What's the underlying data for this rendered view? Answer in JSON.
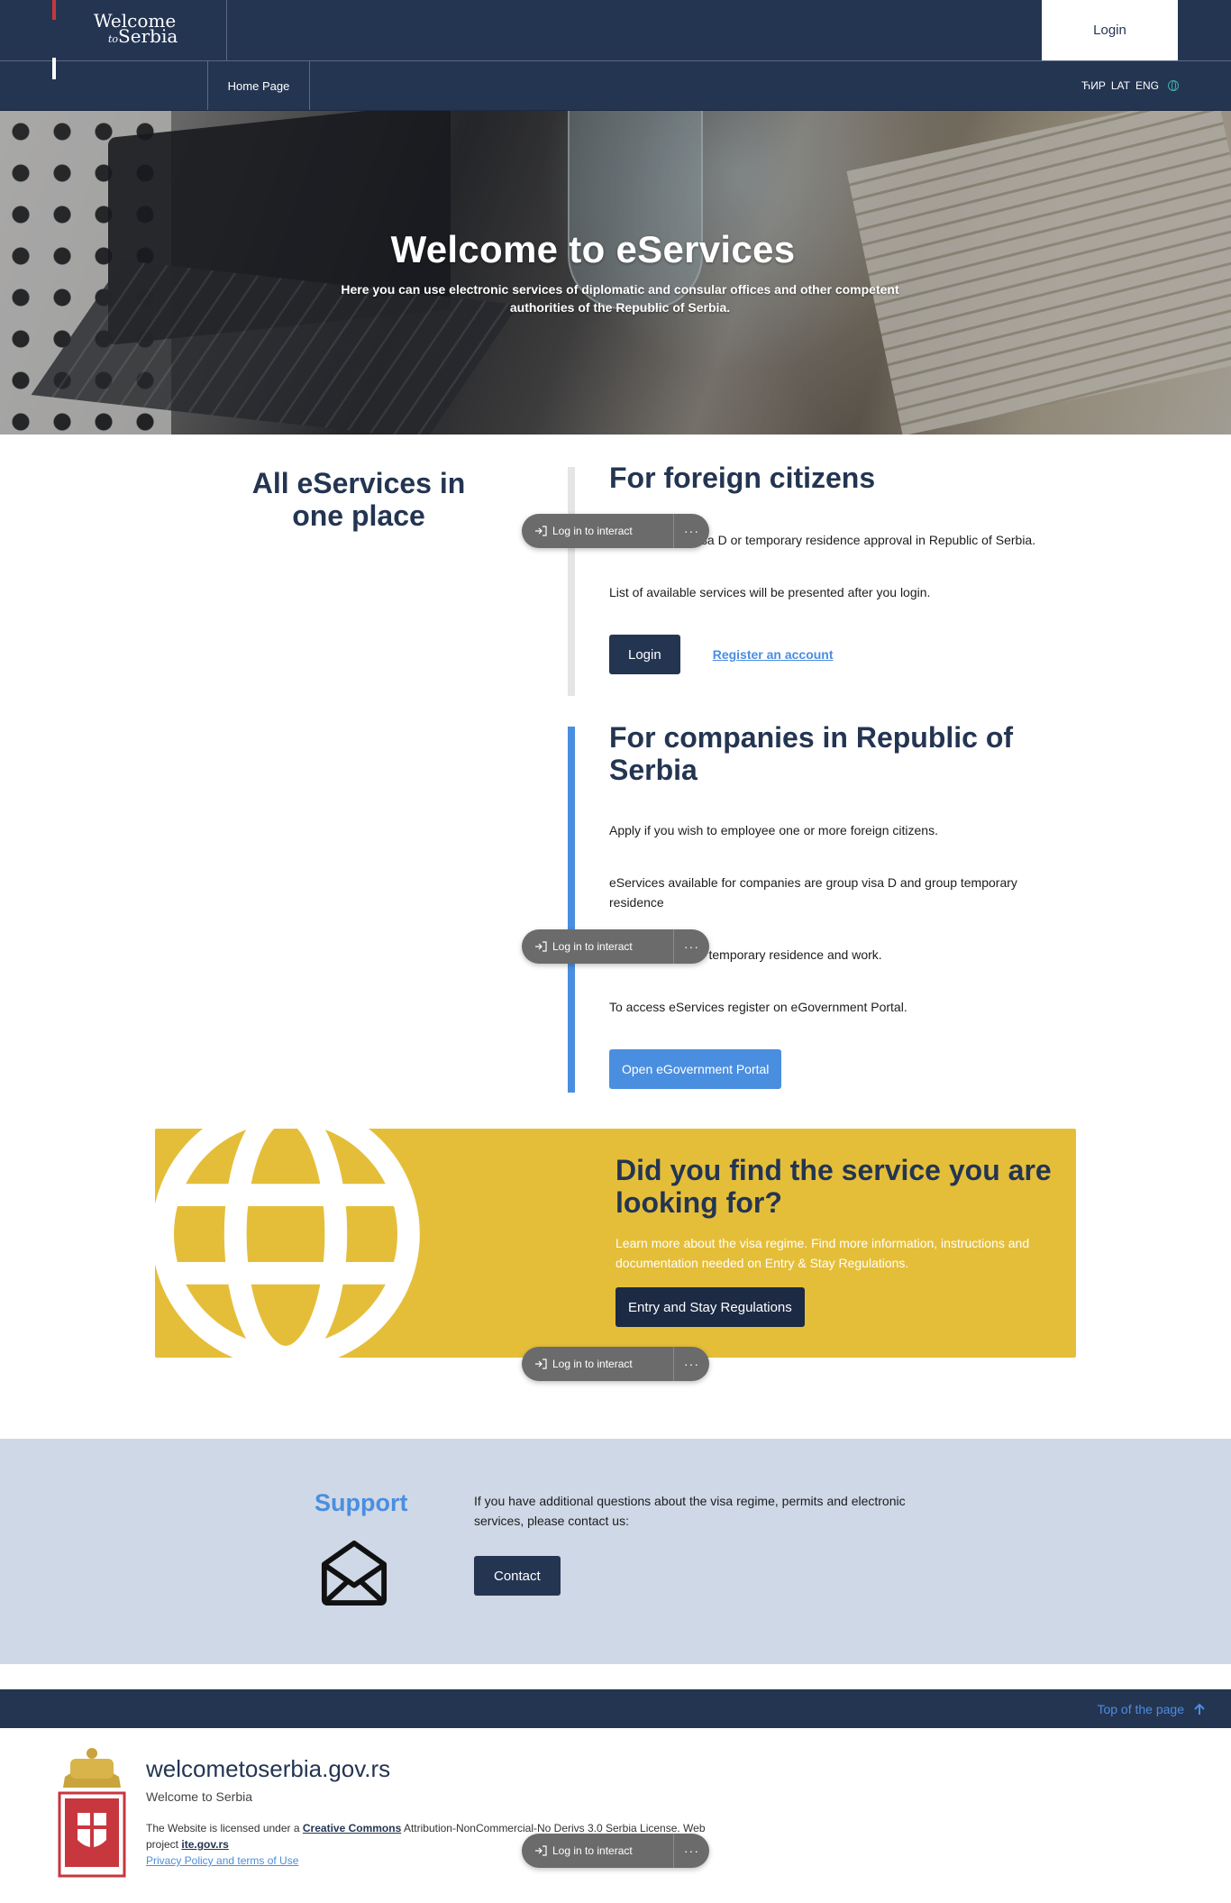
{
  "header": {
    "logo_line1": "Welcome",
    "logo_to": "to",
    "logo_line2": "Serbia",
    "login_label": "Login"
  },
  "nav": {
    "home": "Home Page",
    "lang_cyr": "ЋИР",
    "lang_lat": "LAT",
    "lang_eng": "ENG"
  },
  "hero": {
    "title": "Welcome to eServices",
    "subtitle": "Here you can use electronic services of diplomatic and consular offices and other competent authorities of the Republic of Serbia."
  },
  "services": {
    "all_title": "All eServices in one place",
    "foreign": {
      "title": "For foreign citizens",
      "p1": "Apply for visa, visa D or temporary residence approval in Republic of Serbia.",
      "p2": "List of available services will be presented after you login.",
      "login_label": "Login",
      "register_label": "Register an account"
    },
    "company": {
      "title": "For companies in Republic of Serbia",
      "p1": "Apply if you wish to employee one or more foreign citizens.",
      "p2": "eServices available for companies are group visa D and group temporary residence",
      "p3": "Unified permit for temporary residence and work.",
      "p4": "To access eServices register on eGovernment Portal.",
      "portal_label": "Open eGovernment Portal"
    }
  },
  "find": {
    "title": "Did you find the service you are looking for?",
    "text": "Learn more about the visa regime. Find more information, instructions and documentation needed on Entry & Stay Regulations.",
    "button": "Entry and Stay Regulations"
  },
  "support": {
    "title": "Support",
    "text": "If you have additional questions about the visa regime, permits and electronic services, please contact us:",
    "button": "Contact"
  },
  "footer": {
    "top_link": "Top of the page",
    "site_name": "welcometoserbia.gov.rs",
    "site_sub": "Welcome to Serbia",
    "lic_1": "The Website is licensed under a",
    "lic_cc": "Creative Commons",
    "lic_2": "Attribution-NonCommercial-No Derivs 3.0 Serbia License. Web project",
    "lic_ite": "ite.gov.rs",
    "privacy": "Privacy Policy and terms of Use"
  },
  "overlay": {
    "pill_label": "Log in to interact",
    "pill_more": "···"
  },
  "colors": {
    "navy": "#243552",
    "blue_accent": "#4a8ee0",
    "yellow_banner": "#e5be39",
    "support_bg": "#cfd8e6"
  }
}
